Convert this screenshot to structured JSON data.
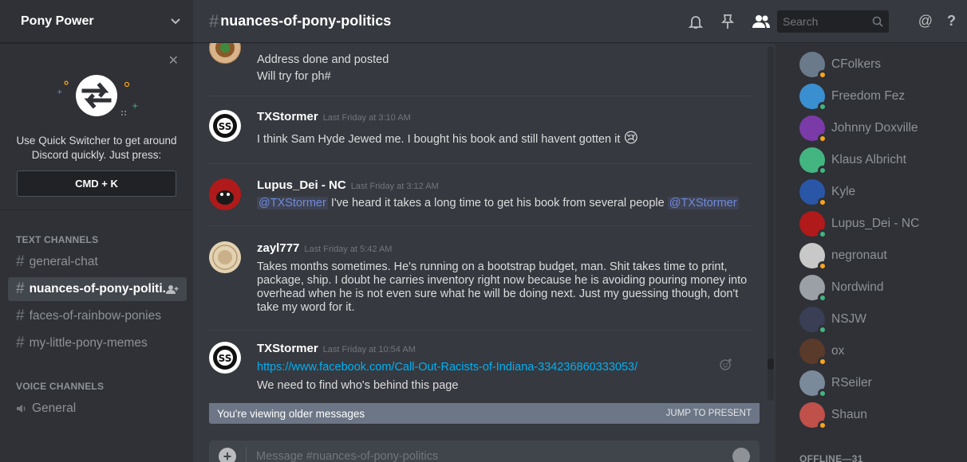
{
  "server": {
    "name": "Pony Power"
  },
  "quick_switcher": {
    "text": "Use Quick Switcher to get around Discord quickly. Just press:",
    "shortcut": "CMD + K",
    "close": "✕"
  },
  "categories": {
    "text": "TEXT CHANNELS",
    "voice": "VOICE CHANNELS"
  },
  "text_channels": [
    {
      "name": "general-chat",
      "active": false
    },
    {
      "name": "nuances-of-pony-politi...",
      "active": true
    },
    {
      "name": "faces-of-rainbow-ponies",
      "active": false
    },
    {
      "name": "my-little-pony-memes",
      "active": false
    }
  ],
  "voice_channels": [
    {
      "name": "General"
    }
  ],
  "channel": {
    "hash": "#",
    "title": "nuances-of-pony-politics"
  },
  "search": {
    "placeholder": "Search"
  },
  "messages": [
    {
      "author": "",
      "time": "",
      "lines": [
        "Address done and posted",
        "Will try for ph#"
      ]
    },
    {
      "author": "TXStormer",
      "time": "Last Friday at 3:10 AM",
      "text": "I think Sam Hyde Jewed me. I bought his book and still havent gotten it",
      "emoji": "😢"
    },
    {
      "author": "Lupus_Dei - NC",
      "time": "Last Friday at 3:12 AM",
      "mention1": "@TXStormer",
      "text": " I've heard it takes a long time to get his book from several people ",
      "mention2": "@TXStormer"
    },
    {
      "author": "zayl777",
      "time": "Last Friday at 5:42 AM",
      "text": "Takes months sometimes. He's running on a bootstrap budget, man. Shit takes time to print, package, ship. I doubt he carries inventory right now because he is avoiding pouring money into overhead when he is not even sure what he will be doing next. Just my guessing though, don't take my word for it."
    },
    {
      "author": "TXStormer",
      "time": "Last Friday at 10:54 AM",
      "link": "https://www.facebook.com/Call-Out-Racists-of-Indiana-334236860333053/",
      "text": "We need to find who's behind this page"
    }
  ],
  "older_bar": {
    "label": "You're viewing older messages",
    "action": "JUMP TO PRESENT"
  },
  "composer": {
    "placeholder": "Message #nuances-of-pony-politics"
  },
  "members": [
    {
      "name": "CFolkers",
      "status": "idle",
      "avatar": "#6a7a8a"
    },
    {
      "name": "Freedom Fez",
      "status": "online",
      "avatar": "#3a8fd0"
    },
    {
      "name": "Johnny Doxville",
      "status": "idle",
      "avatar": "#7a3aa8"
    },
    {
      "name": "Klaus Albricht",
      "status": "online",
      "avatar": "#43b581"
    },
    {
      "name": "Kyle",
      "status": "idle",
      "avatar": "#2a56a8"
    },
    {
      "name": "Lupus_Dei - NC",
      "status": "online",
      "avatar": "#b01a1a"
    },
    {
      "name": "negronaut",
      "status": "idle",
      "avatar": "#c8c8c8"
    },
    {
      "name": "Nordwind",
      "status": "online",
      "avatar": "#9aa0a6"
    },
    {
      "name": "NSJW",
      "status": "online",
      "avatar": "#3b3f55"
    },
    {
      "name": "ox",
      "status": "idle",
      "avatar": "#5a3a2a"
    },
    {
      "name": "RSeiler",
      "status": "online",
      "avatar": "#7a8a9a"
    },
    {
      "name": "Shaun",
      "status": "idle",
      "avatar": "#c0504a"
    }
  ],
  "offline_label": "OFFLINE—31",
  "colors": {
    "online": "#43b581",
    "idle": "#faa61a",
    "accent": "#7289da",
    "link": "#00b0f4"
  }
}
